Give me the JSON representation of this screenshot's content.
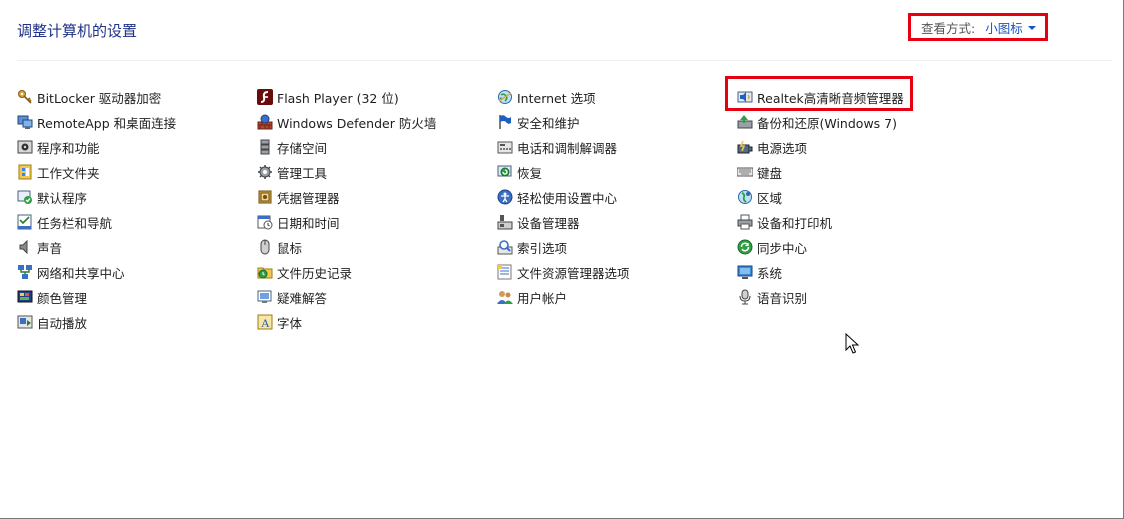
{
  "header": {
    "title": "调整计算机的设置",
    "view_by_label": "查看方式:",
    "view_by_value": "小图标"
  },
  "columns": [
    {
      "items": [
        {
          "label": "BitLocker 驱动器加密",
          "icon": "bitlocker-key-icon"
        },
        {
          "label": "RemoteApp 和桌面连接",
          "icon": "remote-desktop-icon"
        },
        {
          "label": "程序和功能",
          "icon": "programs-icon"
        },
        {
          "label": "工作文件夹",
          "icon": "work-folders-icon"
        },
        {
          "label": "默认程序",
          "icon": "default-programs-icon"
        },
        {
          "label": "任务栏和导航",
          "icon": "taskbar-icon"
        },
        {
          "label": "声音",
          "icon": "speaker-icon"
        },
        {
          "label": "网络和共享中心",
          "icon": "network-icon"
        },
        {
          "label": "颜色管理",
          "icon": "color-management-icon"
        },
        {
          "label": "自动播放",
          "icon": "autoplay-icon"
        }
      ]
    },
    {
      "items": [
        {
          "label": "Flash Player (32 位)",
          "icon": "flash-icon"
        },
        {
          "label": "Windows Defender 防火墙",
          "icon": "firewall-icon"
        },
        {
          "label": "存储空间",
          "icon": "storage-icon"
        },
        {
          "label": "管理工具",
          "icon": "admin-tools-icon"
        },
        {
          "label": "凭据管理器",
          "icon": "credential-vault-icon"
        },
        {
          "label": "日期和时间",
          "icon": "calendar-icon"
        },
        {
          "label": "鼠标",
          "icon": "mouse-icon"
        },
        {
          "label": "文件历史记录",
          "icon": "file-history-icon"
        },
        {
          "label": "疑难解答",
          "icon": "troubleshoot-icon"
        },
        {
          "label": "字体",
          "icon": "font-icon"
        }
      ]
    },
    {
      "items": [
        {
          "label": "Internet 选项",
          "icon": "internet-globe-icon"
        },
        {
          "label": "安全和维护",
          "icon": "flag-icon"
        },
        {
          "label": "电话和调制解调器",
          "icon": "modem-icon"
        },
        {
          "label": "恢复",
          "icon": "recovery-icon"
        },
        {
          "label": "轻松使用设置中心",
          "icon": "ease-of-access-icon"
        },
        {
          "label": "设备管理器",
          "icon": "device-manager-icon"
        },
        {
          "label": "索引选项",
          "icon": "indexing-icon"
        },
        {
          "label": "文件资源管理器选项",
          "icon": "folder-options-icon"
        },
        {
          "label": "用户帐户",
          "icon": "user-accounts-icon"
        }
      ]
    },
    {
      "items": [
        {
          "label": "Realtek高清晰音频管理器",
          "icon": "realtek-audio-icon"
        },
        {
          "label": "备份和还原(Windows 7)",
          "icon": "backup-icon"
        },
        {
          "label": "电源选项",
          "icon": "power-icon"
        },
        {
          "label": "键盘",
          "icon": "keyboard-icon"
        },
        {
          "label": "区域",
          "icon": "region-globe-icon"
        },
        {
          "label": "设备和打印机",
          "icon": "printer-icon"
        },
        {
          "label": "同步中心",
          "icon": "sync-icon"
        },
        {
          "label": "系统",
          "icon": "monitor-icon"
        },
        {
          "label": "语音识别",
          "icon": "microphone-icon"
        }
      ]
    }
  ],
  "colors": {
    "title": "#1e3287",
    "link": "#1a55c8",
    "highlight_border": "#e60012"
  }
}
